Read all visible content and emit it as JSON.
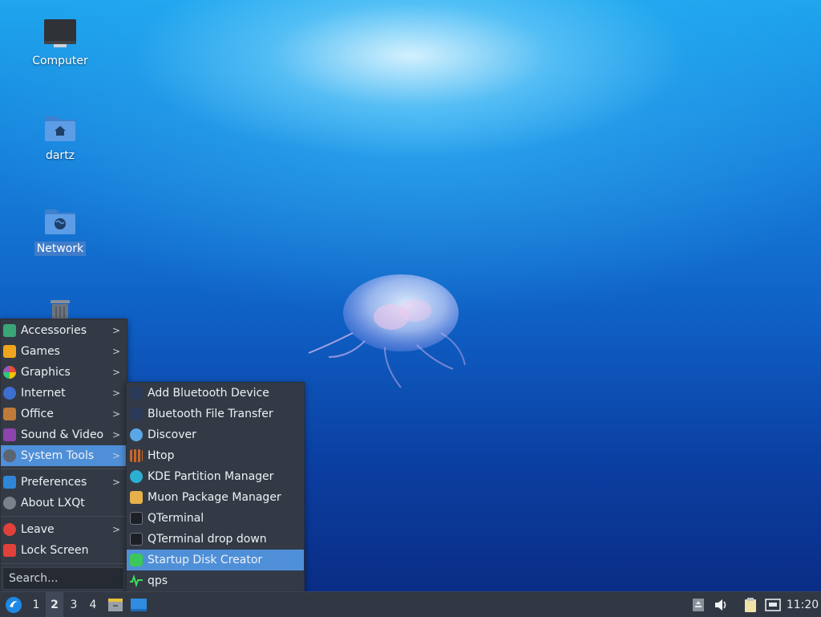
{
  "desktop": {
    "icons": [
      {
        "label": "Computer"
      },
      {
        "label": "dartz"
      },
      {
        "label": "Network"
      },
      {
        "label": ""
      }
    ]
  },
  "main_menu": {
    "items": [
      {
        "label": "Accessories",
        "icon": "accessories-icon",
        "has_submenu": true
      },
      {
        "label": "Games",
        "icon": "games-icon",
        "has_submenu": true
      },
      {
        "label": "Graphics",
        "icon": "graphics-icon",
        "has_submenu": true
      },
      {
        "label": "Internet",
        "icon": "internet-icon",
        "has_submenu": true
      },
      {
        "label": "Office",
        "icon": "office-icon",
        "has_submenu": true
      },
      {
        "label": "Sound & Video",
        "icon": "sound-video-icon",
        "has_submenu": true
      },
      {
        "label": "System Tools",
        "icon": "system-tools-icon",
        "has_submenu": true,
        "highlighted": true
      },
      {
        "label": "Preferences",
        "icon": "preferences-icon",
        "has_submenu": true
      },
      {
        "label": "About LXQt",
        "icon": "info-icon",
        "has_submenu": false
      },
      {
        "label": "Leave",
        "icon": "power-icon",
        "has_submenu": true
      },
      {
        "label": "Lock Screen",
        "icon": "lock-icon",
        "has_submenu": false
      }
    ],
    "search_placeholder": "Search...",
    "submenu_arrow": ">"
  },
  "system_tools_menu": {
    "items": [
      {
        "label": "Add Bluetooth Device",
        "icon": "bluetooth-icon"
      },
      {
        "label": "Bluetooth File Transfer",
        "icon": "bluetooth-icon"
      },
      {
        "label": "Discover",
        "icon": "discover-icon"
      },
      {
        "label": "Htop",
        "icon": "htop-icon"
      },
      {
        "label": "KDE Partition Manager",
        "icon": "partition-manager-icon"
      },
      {
        "label": "Muon Package Manager",
        "icon": "package-manager-icon"
      },
      {
        "label": "QTerminal",
        "icon": "terminal-icon"
      },
      {
        "label": "QTerminal drop down",
        "icon": "terminal-icon"
      },
      {
        "label": "Startup Disk Creator",
        "icon": "startup-disk-icon",
        "highlighted": true
      },
      {
        "label": "qps",
        "icon": "process-monitor-icon"
      }
    ]
  },
  "taskbar": {
    "workspaces": [
      "1",
      "2",
      "3",
      "4"
    ],
    "active_workspace": "2",
    "clock": "11:20"
  },
  "colors": {
    "menu_bg": "#333a45",
    "highlight": "#4f8fd8",
    "taskbar_bg": "#323843"
  }
}
